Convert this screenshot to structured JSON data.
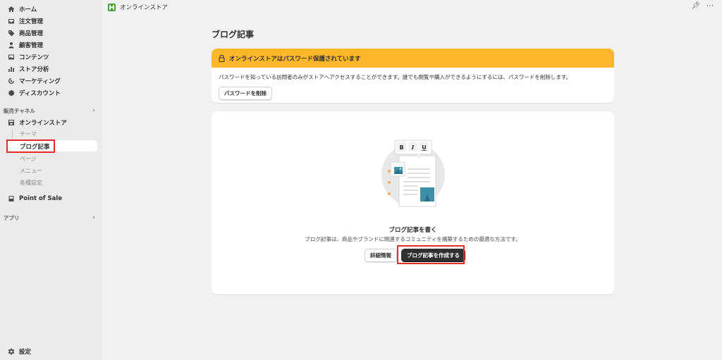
{
  "sidebar": {
    "items": [
      {
        "label": "ホーム"
      },
      {
        "label": "注文管理"
      },
      {
        "label": "商品管理"
      },
      {
        "label": "顧客管理"
      },
      {
        "label": "コンテンツ"
      },
      {
        "label": "ストア分析"
      },
      {
        "label": "マーケティング"
      },
      {
        "label": "ディスカウント"
      }
    ],
    "sales_channels_label": "販売チャネル",
    "online_store": "オンラインストア",
    "sub_items": [
      "テーマ",
      "ブログ記事",
      "ページ",
      "メニュー",
      "各種設定"
    ],
    "pos": "Point of Sale",
    "apps_label": "アプリ",
    "settings": "設定"
  },
  "topbar": {
    "store_name": "オンラインストア"
  },
  "main": {
    "title": "ブログ記事",
    "banner": {
      "heading": "オンラインストアはパスワード保護されています",
      "body": "パスワードを知っている訪問者のみがストアへアクセスすることができます。誰でも閲覧や購入ができるようにするには、パスワードを削除します。",
      "button": "パスワードを削除"
    },
    "empty": {
      "title": "ブログ記事を書く",
      "description": "ブログ記事は、商品やブランドに関連するコミュニティを構築するための最適な方法です。",
      "secondary_button": "詳細情報",
      "primary_button": "ブログ記事を作成する"
    }
  },
  "colors": {
    "banner": "#ffb72a",
    "highlight": "#e52b2b",
    "primary_button": "#303030"
  }
}
